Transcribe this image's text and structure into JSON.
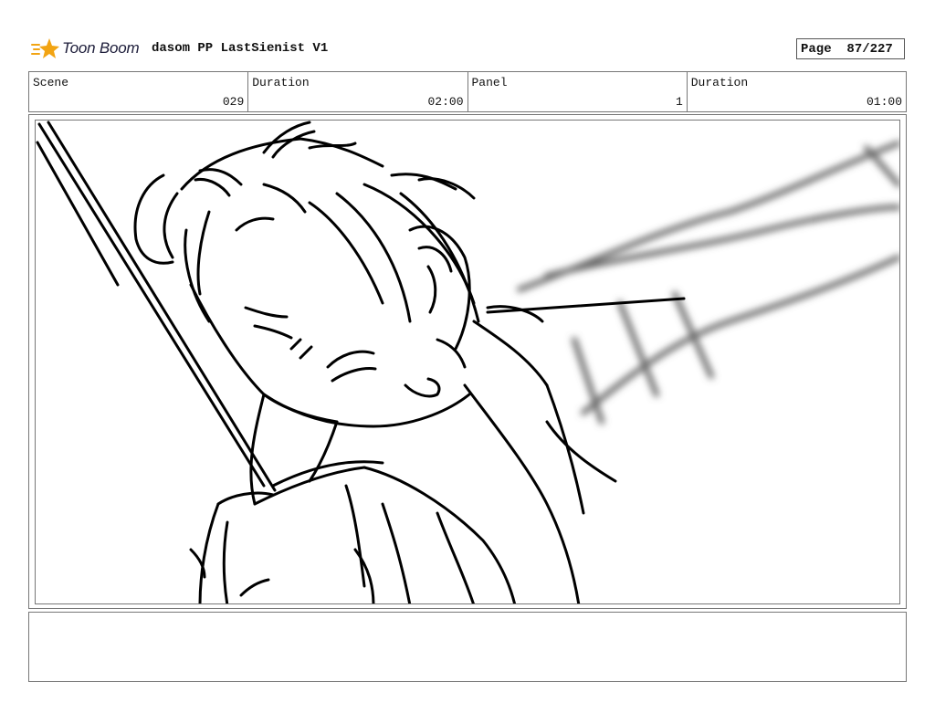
{
  "header": {
    "logo_text": "Toon Boom",
    "project_title": "dasom PP LastSienist V1",
    "page_label": "Page",
    "page_value": "87/227"
  },
  "info": {
    "scene_label": "Scene",
    "scene_value": "029",
    "scene_duration_label": "Duration",
    "scene_duration_value": "02:00",
    "panel_label": "Panel",
    "panel_value": "1",
    "panel_duration_label": "Duration",
    "panel_duration_value": "01:00"
  },
  "panel": {
    "icon": "sketch-drawing"
  },
  "notes": {
    "text": ""
  },
  "colors": {
    "logo_orange": "#f2a413",
    "logo_text": "#1d1d3a",
    "border": "#777777"
  }
}
